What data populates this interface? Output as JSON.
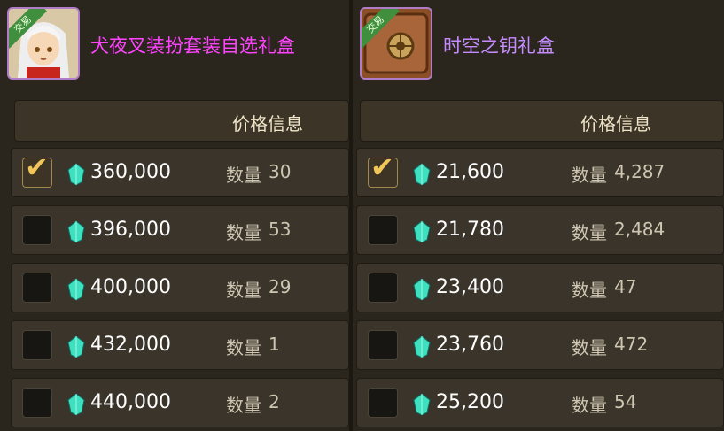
{
  "left_item": {
    "title": "犬夜叉装扮套装自选礼盒",
    "trade_badge": "交易",
    "icon": "inuyasha-avatar-icon",
    "header": "价格信息",
    "rows": [
      {
        "price": "360,000",
        "qty_label": "数量",
        "qty": "30",
        "checked": true
      },
      {
        "price": "396,000",
        "qty_label": "数量",
        "qty": "53",
        "checked": false
      },
      {
        "price": "400,000",
        "qty_label": "数量",
        "qty": "29",
        "checked": false
      },
      {
        "price": "432,000",
        "qty_label": "数量",
        "qty": "1",
        "checked": false
      },
      {
        "price": "440,000",
        "qty_label": "数量",
        "qty": "2",
        "checked": false
      }
    ]
  },
  "right_item": {
    "title": "时空之钥礼盒",
    "trade_badge": "交易",
    "icon": "gift-box-icon",
    "header": "价格信息",
    "rows": [
      {
        "price": "21,600",
        "qty_label": "数量",
        "qty": "4,287",
        "checked": true
      },
      {
        "price": "21,780",
        "qty_label": "数量",
        "qty": "2,484",
        "checked": false
      },
      {
        "price": "23,400",
        "qty_label": "数量",
        "qty": "47",
        "checked": false
      },
      {
        "price": "23,760",
        "qty_label": "数量",
        "qty": "472",
        "checked": false
      },
      {
        "price": "25,200",
        "qty_label": "数量",
        "qty": "54",
        "checked": false
      }
    ]
  },
  "colors": {
    "left_title": "#ff44ff",
    "right_title": "#c58cff",
    "gem": "#3fe0c0",
    "check": "#f0c65a"
  }
}
